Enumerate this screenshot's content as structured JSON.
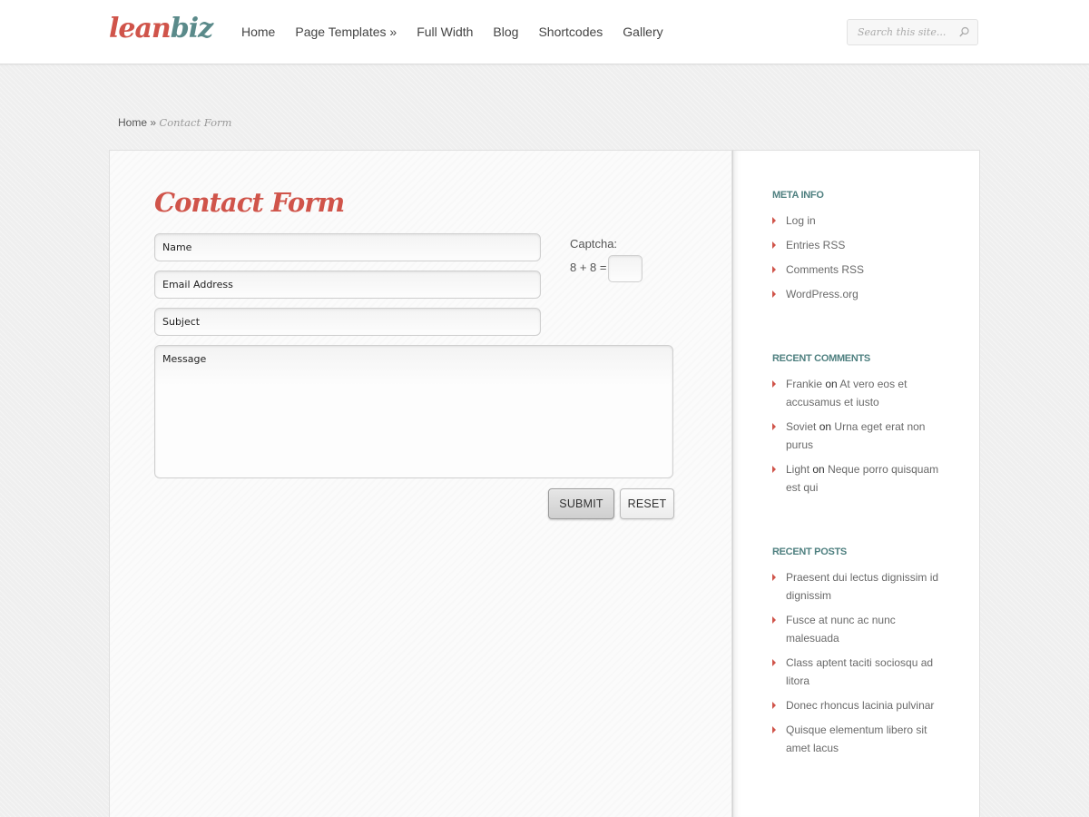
{
  "header": {
    "logo": {
      "part1": "lean",
      "part2": "biz"
    },
    "nav": [
      {
        "label": "Home"
      },
      {
        "label": "Page Templates »"
      },
      {
        "label": "Full Width"
      },
      {
        "label": "Blog"
      },
      {
        "label": "Shortcodes"
      },
      {
        "label": "Gallery"
      }
    ],
    "search": {
      "placeholder": "Search this site..."
    }
  },
  "breadcrumb": {
    "home": "Home",
    "separator": "»",
    "current": "Contact Form"
  },
  "main": {
    "title": "Contact Form",
    "form": {
      "name_placeholder": "Name",
      "email_placeholder": "Email Address",
      "subject_placeholder": "Subject",
      "message_placeholder": "Message",
      "captcha_label": "Captcha:",
      "captcha_question": "8 + 8 =",
      "submit_label": "SUBMIT",
      "reset_label": "RESET"
    }
  },
  "sidebar": {
    "meta": {
      "title": "META INFO",
      "items": [
        {
          "label": "Log in"
        },
        {
          "label": "Entries RSS"
        },
        {
          "label": "Comments RSS"
        },
        {
          "label": "WordPress.org"
        }
      ]
    },
    "recent_comments": {
      "title": "RECENT COMMENTS",
      "items": [
        {
          "author": "Frankie",
          "on": "on",
          "post": "At vero eos et accusamus et iusto"
        },
        {
          "author": "Soviet",
          "on": "on",
          "post": "Urna eget erat non purus"
        },
        {
          "author": "Light",
          "on": "on",
          "post": "Neque porro quisquam est qui"
        }
      ]
    },
    "recent_posts": {
      "title": "RECENT POSTS",
      "items": [
        {
          "label": "Praesent dui lectus dignissim id dignissim"
        },
        {
          "label": "Fusce at nunc ac nunc malesuada"
        },
        {
          "label": "Class aptent taciti sociosqu ad litora"
        },
        {
          "label": "Donec rhoncus lacinia pulvinar"
        },
        {
          "label": "Quisque elementum libero sit amet lacus"
        }
      ]
    }
  },
  "colors": {
    "accent": "#d0544a",
    "teal": "#5a8a8a",
    "widget_title": "#4f8080"
  }
}
